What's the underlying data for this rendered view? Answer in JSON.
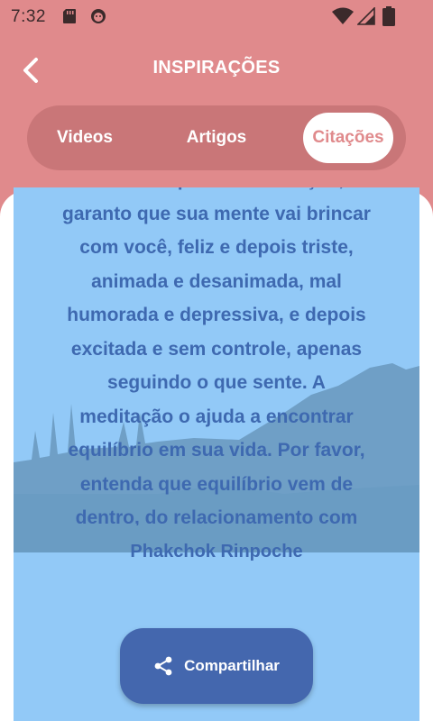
{
  "status_bar": {
    "time": "7:32",
    "icons": [
      "sd-card-icon",
      "face-icon",
      "wifi-icon",
      "signal-icon",
      "battery-icon"
    ]
  },
  "header": {
    "title": "INSPIRAÇÕES",
    "back_icon": "back-arrow-icon"
  },
  "tabs": [
    {
      "label": "Videos",
      "selected": false
    },
    {
      "label": "Artigos",
      "selected": false
    },
    {
      "label": "Citações",
      "selected": true
    }
  ],
  "quote": {
    "text_lines": [
      "Se você não pratica meditação, eu",
      "garanto que sua mente vai brincar",
      "com você, feliz e depois triste,",
      "animada e desanimada, mal",
      "humorada e depressiva, e depois",
      "excitada e sem controle, apenas",
      "seguindo o que sente. A",
      "meditação o ajuda a encontrar",
      "equilíbrio em sua vida. Por favor,",
      "entenda que equilíbrio vem de",
      "dentro, do relacionamento com"
    ],
    "author": "Phakchok Rinpoche"
  },
  "share_button": {
    "label": "Compartilhar",
    "icon": "share-icon"
  },
  "colors": {
    "header": "#e08a8c",
    "tab_track": "#c97678",
    "card": "#92c9f7",
    "mountain": "#6f9fc6",
    "text": "#3e69b0",
    "button": "#4467ae"
  }
}
